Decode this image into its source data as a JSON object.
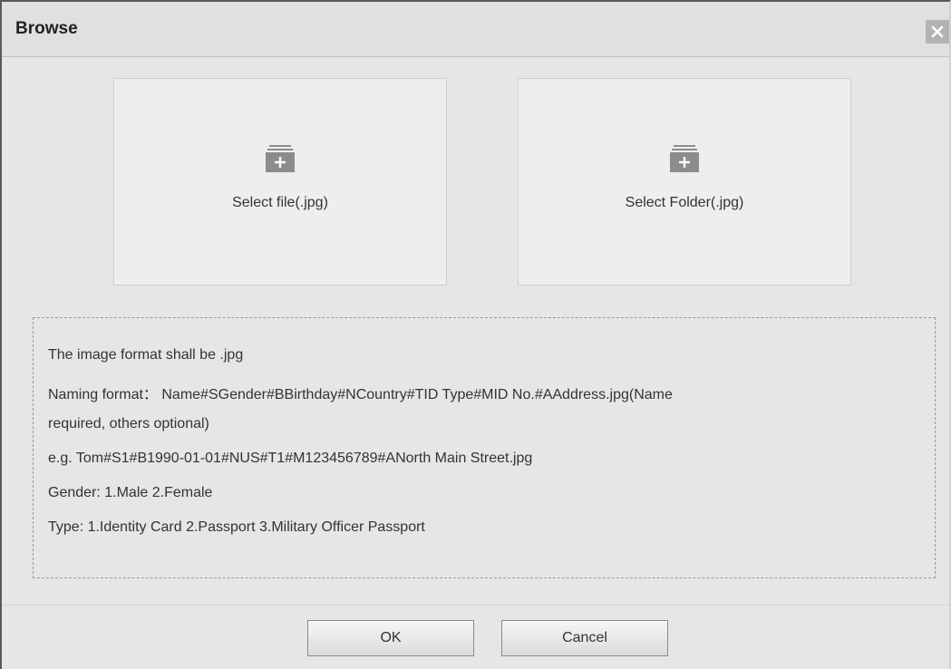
{
  "dialog": {
    "title": "Browse",
    "close_icon": "close-icon"
  },
  "cards": {
    "file": {
      "label": "Select file(.jpg)",
      "icon": "add-file-icon"
    },
    "folder": {
      "label": "Select Folder(.jpg)",
      "icon": "add-folder-icon"
    }
  },
  "info": {
    "lines": [
      "The image format shall be .jpg",
      "Naming format： Name#SGender#BBirthday#NCountry#TID Type#MID No.#AAddress.jpg(Name",
      "required, others optional)",
      "e.g. Tom#S1#B1990-01-01#NUS#T1#M123456789#ANorth Main Street.jpg",
      "Gender: 1.Male 2.Female",
      "Type: 1.Identity Card 2.Passport 3.Military Officer Passport"
    ]
  },
  "footer": {
    "ok_label": "OK",
    "cancel_label": "Cancel"
  },
  "colors": {
    "dialog_bg": "#e6e6e6",
    "card_bg": "#eeeeee",
    "icon_gray": "#8c8c8c"
  }
}
